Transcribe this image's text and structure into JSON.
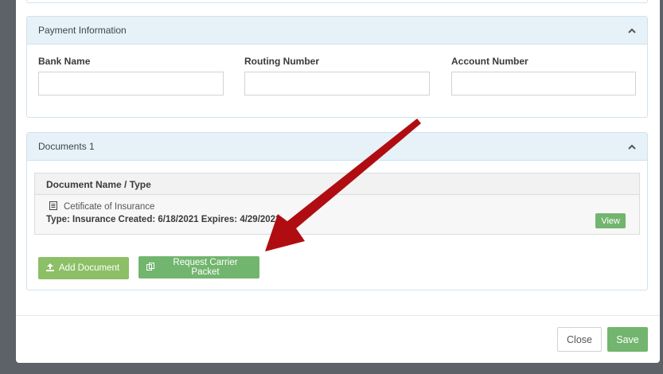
{
  "payment": {
    "title": "Payment Information",
    "bank_name_label": "Bank Name",
    "routing_label": "Routing Number",
    "account_label": "Account Number",
    "bank_name_value": "",
    "routing_value": "",
    "account_value": ""
  },
  "documents": {
    "title": "Documents 1",
    "column_header": "Document Name / Type",
    "rows": [
      {
        "name": "Cetificate of Insurance",
        "meta": "Type: Insurance Created: 6/18/2021 Expires: 4/29/2022",
        "view_label": "View"
      }
    ],
    "add_document_label": "Add Document",
    "request_packet_label": "Request Carrier Packet"
  },
  "footer": {
    "close_label": "Close",
    "save_label": "Save"
  },
  "colors": {
    "green_primary": "#72b56e",
    "green_secondary": "#8cbf66",
    "panel_header": "#e6f1f8",
    "annotation_arrow": "#b00d12"
  },
  "icons": [
    "chevron-up-icon",
    "document-icon",
    "upload-icon",
    "copy-icon"
  ]
}
